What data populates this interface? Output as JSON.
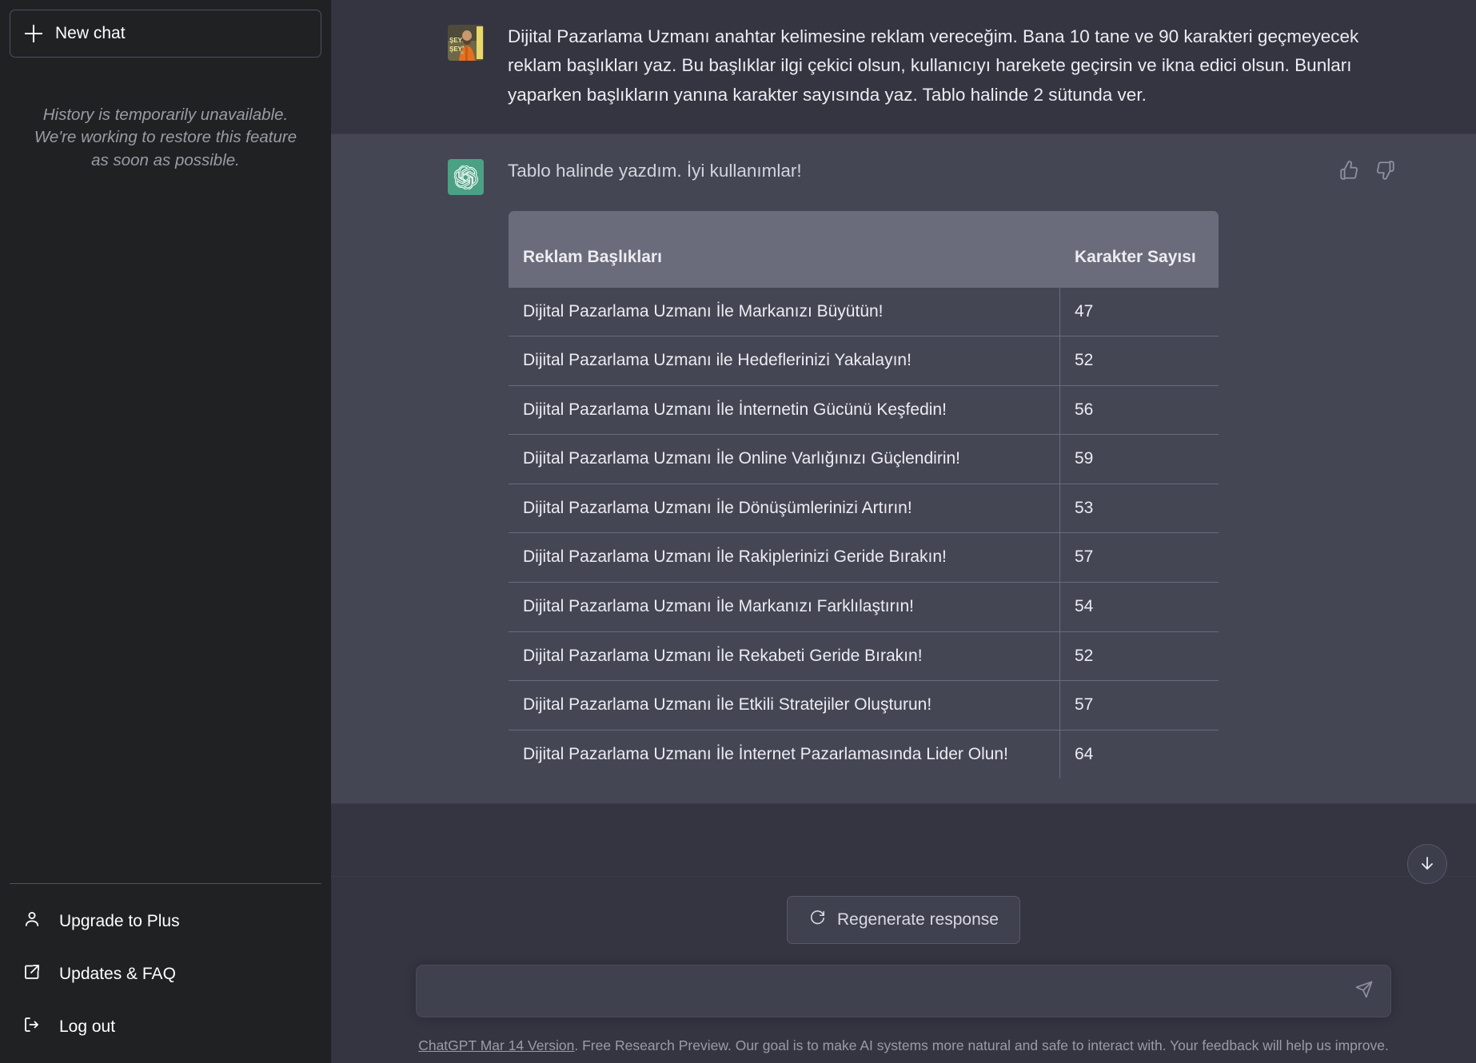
{
  "sidebar": {
    "new_chat_label": "New chat",
    "new_chat_icon": "plus-icon",
    "history_note": "History is temporarily unavailable. We're working to restore this feature as soon as possible.",
    "nav_items": [
      {
        "label": "Upgrade to Plus",
        "icon": "person-icon"
      },
      {
        "label": "Updates & FAQ",
        "icon": "external-link-icon"
      },
      {
        "label": "Log out",
        "icon": "logout-icon"
      }
    ]
  },
  "conversation": {
    "user_message": {
      "avatar_icon": "user-photo-avatar",
      "text": "Dijital Pazarlama Uzmanı anahtar kelimesine reklam vereceğim. Bana 10 tane ve 90 karakteri geçmeyecek reklam başlıkları yaz. Bu başlıklar ilgi çekici olsun, kullanıcıyı harekete geçirsin ve ikna edici olsun. Bunları yaparken başlıkların yanına karakter sayısında yaz. Tablo halinde 2 sütunda ver."
    },
    "assistant_message": {
      "avatar_icon": "openai-logo-icon",
      "text": "Tablo halinde yazdım. İyi kullanımlar!",
      "feedback": {
        "thumbs_up_icon": "thumbs-up-icon",
        "thumbs_down_icon": "thumbs-down-icon"
      },
      "table": {
        "headers": [
          "Reklam Başlıkları",
          "Karakter Sayısı"
        ],
        "rows": [
          [
            "Dijital Pazarlama Uzmanı İle Markanızı Büyütün!",
            "47"
          ],
          [
            "Dijital Pazarlama Uzmanı ile Hedeflerinizi Yakalayın!",
            "52"
          ],
          [
            "Dijital Pazarlama Uzmanı İle İnternetin Gücünü Keşfedin!",
            "56"
          ],
          [
            "Dijital Pazarlama Uzmanı İle Online Varlığınızı Güçlendirin!",
            "59"
          ],
          [
            "Dijital Pazarlama Uzmanı İle Dönüşümlerinizi Artırın!",
            "53"
          ],
          [
            "Dijital Pazarlama Uzmanı İle Rakiplerinizi Geride Bırakın!",
            "57"
          ],
          [
            "Dijital Pazarlama Uzmanı İle Markanızı Farklılaştırın!",
            "54"
          ],
          [
            "Dijital Pazarlama Uzmanı İle Rekabeti Geride Bırakın!",
            "52"
          ],
          [
            "Dijital Pazarlama Uzmanı İle Etkili Stratejiler Oluşturun!",
            "57"
          ],
          [
            "Dijital Pazarlama Uzmanı İle İnternet Pazarlamasında Lider Olun!",
            "64"
          ]
        ]
      }
    }
  },
  "composer": {
    "regenerate_label": "Regenerate response",
    "regenerate_icon": "refresh-icon",
    "input_value": "",
    "input_placeholder": "",
    "send_icon": "send-plane-icon",
    "scroll_bottom_icon": "arrow-down-icon"
  },
  "footer": {
    "version_link": "ChatGPT Mar 14 Version",
    "disclaimer": ". Free Research Preview. Our goal is to make AI systems more natural and safe to interact with. Your feedback will help us improve."
  },
  "colors": {
    "sidebar_bg": "#202123",
    "user_row_bg": "#343541",
    "assistant_row_bg": "#444654",
    "accent_green": "#4ba183",
    "table_header_bg": "#6b6c7b",
    "muted_text": "#9a9ba4"
  }
}
